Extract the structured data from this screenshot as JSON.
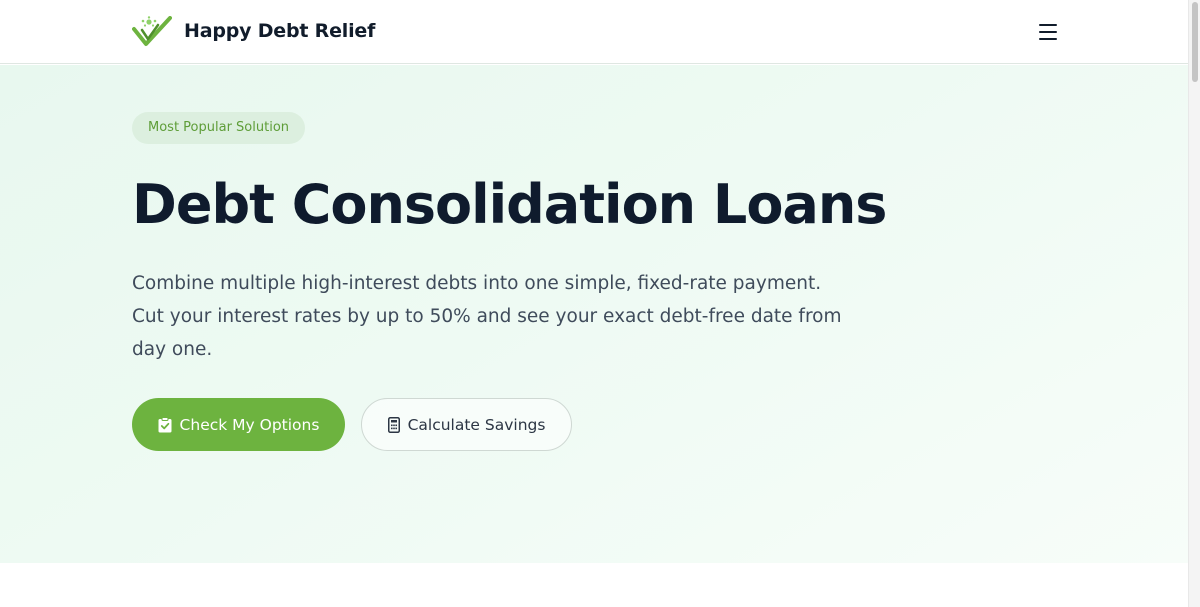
{
  "header": {
    "brand": "Happy Debt Relief",
    "logo_icon": "checkmark-star-logo",
    "menu_icon": "hamburger-menu-icon"
  },
  "hero": {
    "badge": "Most Popular Solution",
    "title": "Debt Consolidation Loans",
    "description_lines": [
      "Combine multiple high-interest debts into one simple, fixed-rate payment.",
      "Cut your interest rates by up to 50% and see your exact debt-free date from",
      "day one."
    ],
    "primary_button": {
      "label": "Check My Options",
      "icon": "clipboard-check-icon"
    },
    "secondary_button": {
      "label": "Calculate Savings",
      "icon": "calculator-icon"
    }
  },
  "colors": {
    "accent": "#6db33f",
    "badge_bg": "#dcefdf",
    "badge_text": "#5e9d38",
    "heading": "#0f1b2d",
    "body_text": "#3f4b5b",
    "hero_bg": "#e8f8ef"
  }
}
